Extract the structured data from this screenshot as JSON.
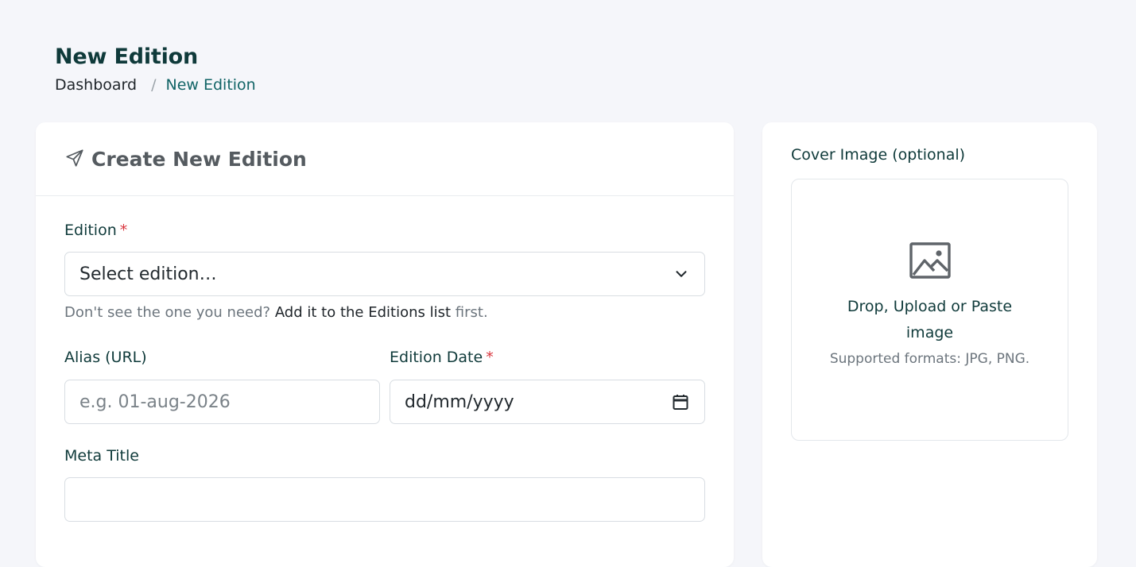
{
  "header": {
    "title": "New Edition",
    "breadcrumb": {
      "home": "Dashboard",
      "separator": "/",
      "current": "New Edition"
    }
  },
  "form": {
    "card_title": "Create New Edition",
    "edition": {
      "label": "Edition",
      "required_mark": "*",
      "selected": "Select edition…",
      "help_prefix": "Don't see the one you need?",
      "help_link": "Add it to the Editions list",
      "help_suffix": "first."
    },
    "alias": {
      "label": "Alias (URL)",
      "placeholder": "e.g. 01-aug-2026",
      "value": ""
    },
    "edition_date": {
      "label": "Edition Date",
      "required_mark": "*",
      "placeholder": "dd/mm/yyyy"
    },
    "meta_title": {
      "label": "Meta Title",
      "value": ""
    }
  },
  "cover": {
    "label": "Cover Image (optional)",
    "drop_text": "Drop, Upload or Paste image",
    "formats": "Supported formats: JPG, PNG."
  },
  "colors": {
    "accent": "#116466",
    "heading": "#0f3a3a",
    "required": "#d9363e",
    "background": "#f5f6fa"
  },
  "icons": {
    "card_header": "send-icon",
    "select": "chevron-down-icon",
    "date": "calendar-icon",
    "dropzone": "image-icon"
  }
}
